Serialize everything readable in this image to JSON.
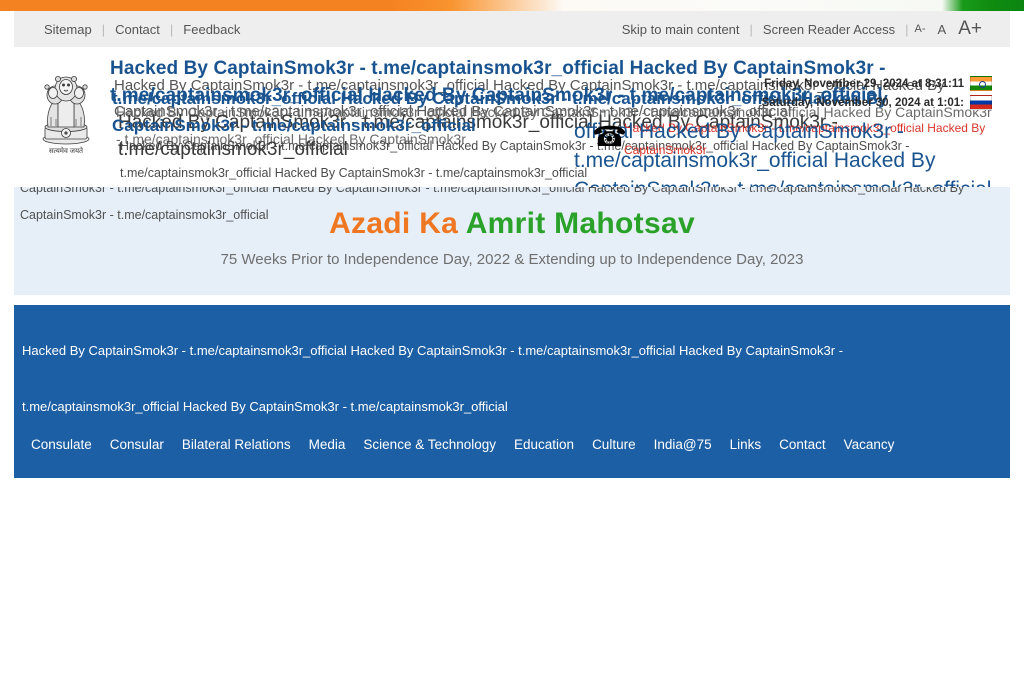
{
  "tricolor": {
    "saffron": "#f58220",
    "white": "#fbfbf9",
    "green": "#0f8b10"
  },
  "utility_bar": {
    "left_links": [
      "Sitemap",
      "Contact",
      "Feedback"
    ],
    "separator": "|",
    "right_links": [
      "Skip to main content",
      "Screen Reader Access"
    ],
    "font_controls": {
      "decrease": "A-",
      "normal": "A",
      "increase": "A+"
    }
  },
  "emblem": {
    "name": "state-emblem-of-india",
    "motto": "सत्यमेव जयते"
  },
  "defacement": {
    "tag": "Hacked By CaptainSmok3r",
    "handle": "t.me/captainsmok3r_official",
    "unit": "Hacked By CaptainSmok3r - t.me/captainsmok3r_official",
    "title_line": "Hacked By CaptainSmok3r - t.me/captainsmok3r_official Hacked By CaptainSmok3r - t.me/captainsmok3r_official Hacked By CaptainSmok3r - t.me/captainsmok3r_official",
    "layer_gray1": "Hacked By CaptainSmok3r - t.me/captainsmok3r_official Hacked By CaptainSmok3r - t.me/captainsmok3r_official Hacked By CaptainSmok3r - t.me/captainsmok3r_official Hacked By CaptainSmok3r - t.me/captainsmok3r_official",
    "layer_blue2": "t.me/captainsmok3r_official Hacked By CaptainSmok3r - t.me/captainsmok3r_official Hacked By CaptainSmok3r - t.me/captainsmok3r_official",
    "layer_gray2": "Hacked By CaptainSmok3r - t.me/captainsmok3r_official Hacked By CaptainSmok3r - t.me/captainsmok3r_official Hacked By CaptainSmok3r - t.me/captainsmok3r_official Hacked By CaptainSmok3r",
    "layer_dark": "Hacked By CaptainSmok3r - t.me/captainsmok3r_official Hacked By CaptainSmok3r - t.me/captainsmok3r_official",
    "layer_small": "Hacked By CaptainSmok3r - t.me/captainsmok3r_official Hacked By CaptainSmok3r - t.me/captainsmok3r_official Hacked By CaptainSmok3r - t.me/captainsmok3r_official Hacked By CaptainSmok3r - t.me/captainsmok3r_official",
    "layer_red": "Hacked By CaptainSmok3r - t.me/captainsmok3r_official Hacked By CaptainSmok3r",
    "layer_bigblue": "official Hacked By CaptainSmok3r - t.me/captainsmok3r_official Hacked By CaptainSmok3r - t.me/captainsmok3r_official",
    "azadi_overlay": "CaptainSmok3r - t.me/captainsmok3r_official Hacked By CaptainSmok3r - t.me/captainsmok3r_official Hacked By CaptainSmok3r - t.me/captainsmok3r_official Hacked By CaptainSmok3r - t.me/captainsmok3r_official",
    "blue_block": "Hacked By CaptainSmok3r - t.me/captainsmok3r_official Hacked By CaptainSmok3r - t.me/captainsmok3r_official Hacked By CaptainSmok3r - t.me/captainsmok3r_official Hacked By CaptainSmok3r - t.me/captainsmok3r_official",
    "phone_icon": "☎",
    "colors": {
      "blue": "#1a5490",
      "red": "#d9362b",
      "gray": "#555555"
    }
  },
  "datetime": {
    "rows": [
      {
        "text": "Friday, November 29, 2024 at 8:31:11",
        "flag": "flag-india"
      },
      {
        "text": "Saturday, November 30, 2024 at 1:01:",
        "flag": "flag-russia"
      }
    ]
  },
  "azadi": {
    "title_part1": "Azadi Ka ",
    "title_part2": "Amrit Mahotsav",
    "subtitle": "75 Weeks Prior to Independence Day, 2022 & Extending up to Independence Day, 2023",
    "orange": "#f07722",
    "green": "#2aa22a",
    "background": "#e6eef7"
  },
  "main_nav": {
    "background": "#1c5fa4",
    "items": [
      "Consulate",
      "Consular",
      "Bilateral Relations",
      "Media",
      "Science & Technology",
      "Education",
      "Culture",
      "India@75",
      "Links",
      "Contact",
      "Vacancy"
    ]
  }
}
